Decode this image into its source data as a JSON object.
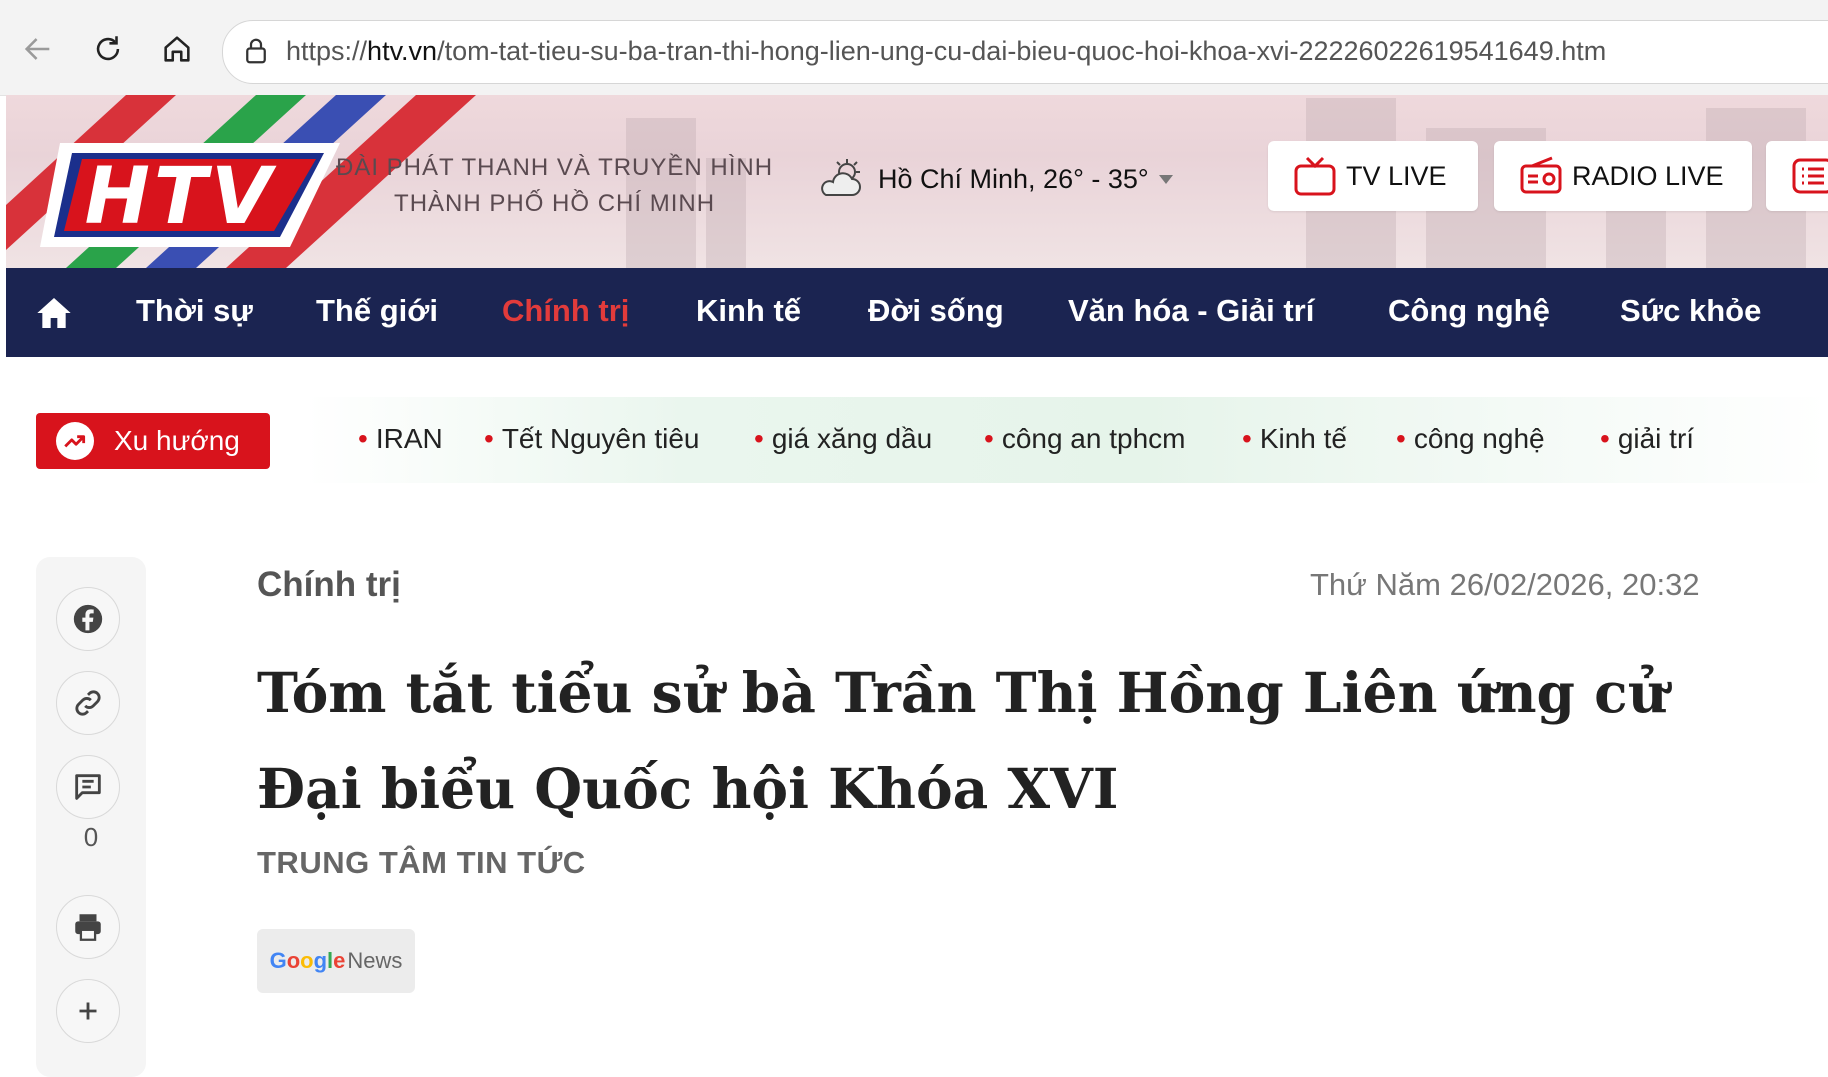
{
  "browser": {
    "url_prefix": "https://",
    "url_domain": "htv.vn",
    "url_path": "/tom-tat-tieu-su-ba-tran-thi-hong-lien-ung-cu-dai-bieu-quoc-hoi-khoa-xvi-22226022619541649.htm"
  },
  "header": {
    "logo_text": "HTV",
    "org_line1": "ĐÀI PHÁT THANH VÀ TRUYỀN HÌNH",
    "org_line2": "THÀNH PHỐ HỒ CHÍ MINH",
    "weather": "Hồ Chí Minh, 26° - 35°",
    "tv_live": "TV LIVE",
    "radio_live": "RADIO LIVE"
  },
  "nav": {
    "items": [
      {
        "label": "Thời sự"
      },
      {
        "label": "Thế giới"
      },
      {
        "label": "Chính trị"
      },
      {
        "label": "Kinh tế"
      },
      {
        "label": "Đời sống"
      },
      {
        "label": "Văn hóa - Giải trí"
      },
      {
        "label": "Công nghệ"
      },
      {
        "label": "Sức khỏe"
      }
    ],
    "active": "Chính trị"
  },
  "trending": {
    "label": "Xu hướng",
    "tags": [
      "IRAN",
      "Tết Nguyên tiêu",
      "giá xăng dầu",
      "công an tphcm",
      "Kinh tế",
      "công nghệ",
      "giải trí"
    ]
  },
  "share": {
    "comment_count": "0"
  },
  "article": {
    "category": "Chính trị",
    "datetime": "Thứ Năm 26/02/2026, 20:32",
    "title": "Tóm tắt tiểu sử bà Trần Thị Hồng Liên ứng cử Đại biểu Quốc hội Khóa XVI",
    "author": "TRUNG TÂM TIN TỨC",
    "gnews_google": "Google",
    "gnews_news": "News"
  },
  "colors": {
    "nav_bg": "#1b2451",
    "accent_red": "#d8131c",
    "active_nav": "#e23b3b"
  }
}
